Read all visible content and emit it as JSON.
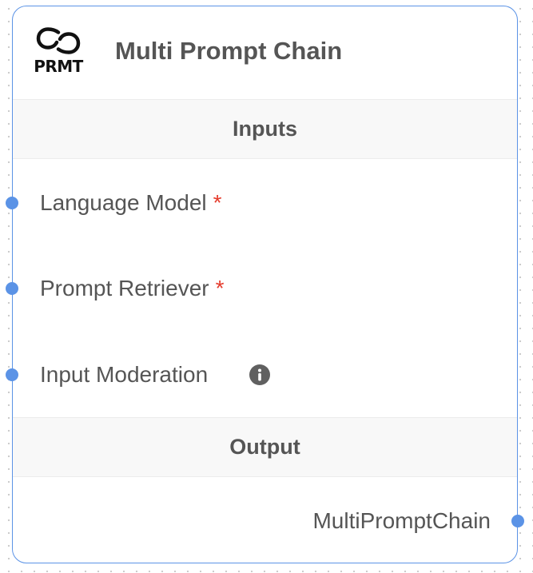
{
  "node": {
    "title": "Multi Prompt Chain",
    "logo_text": "PRMT",
    "icons": {
      "logo": "link-chain-icon",
      "info": "info-icon"
    },
    "colors": {
      "accent": "#5b93e6",
      "required": "#e53b2c",
      "text": "#555555"
    }
  },
  "inputs": {
    "header": "Inputs",
    "params": [
      {
        "label": "Language Model",
        "required_mark": "*"
      },
      {
        "label": "Prompt Retriever",
        "required_mark": "*"
      },
      {
        "label": "Input Moderation",
        "required_mark": ""
      }
    ]
  },
  "output": {
    "header": "Output",
    "label": "MultiPromptChain"
  }
}
